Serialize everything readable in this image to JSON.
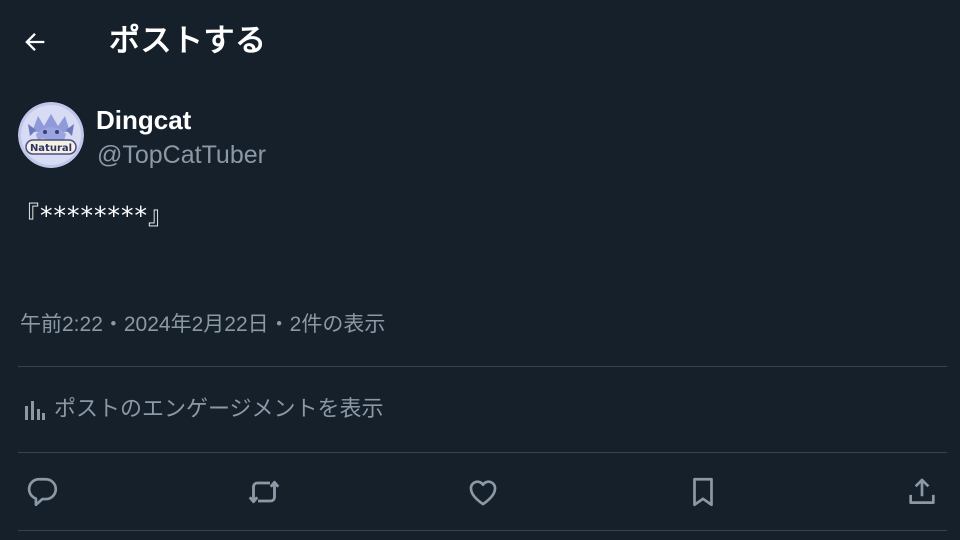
{
  "header": {
    "title": "ポストする",
    "back_icon": "arrow-left-icon"
  },
  "author": {
    "name": "Dingcat",
    "handle": "@TopCatTuber",
    "avatar_badge_text": "Natural"
  },
  "post": {
    "text": "『********』"
  },
  "meta": {
    "time": "午前2:22",
    "separator1": "・",
    "date": "2024年2月22日",
    "separator2": "・",
    "views_count": "2件",
    "views_label": "の表示"
  },
  "engagement": {
    "icon": "analytics-bars-icon",
    "label": "ポストのエンゲージメントを表示"
  },
  "actions": [
    {
      "name": "reply",
      "icon": "reply-bubble-icon"
    },
    {
      "name": "repost",
      "icon": "repost-arrows-icon"
    },
    {
      "name": "like",
      "icon": "heart-icon"
    },
    {
      "name": "bookmark",
      "icon": "bookmark-icon"
    },
    {
      "name": "share",
      "icon": "share-upload-icon"
    }
  ],
  "colors": {
    "background": "#15202b",
    "primary_text": "#ffffff",
    "secondary_text": "#8b98a5",
    "divider": "#38444d"
  }
}
